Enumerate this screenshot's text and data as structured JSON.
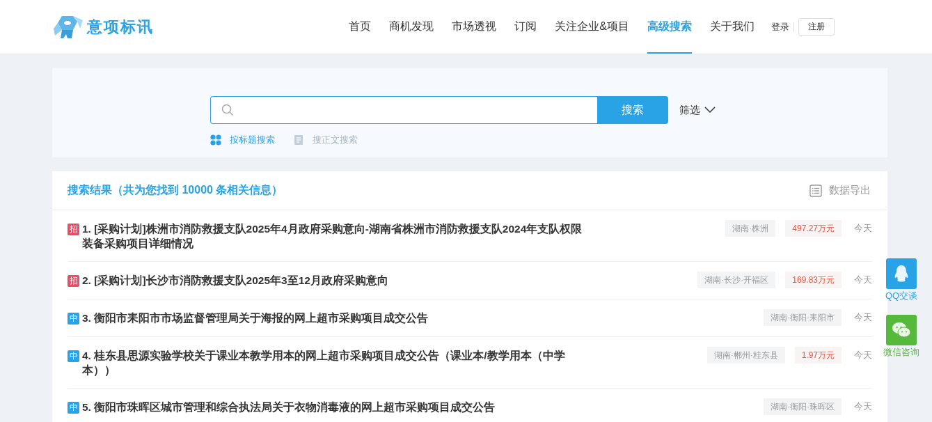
{
  "logo": {
    "text": "意项标讯"
  },
  "nav": [
    {
      "label": "首页",
      "selected": false
    },
    {
      "label": "商机发现",
      "selected": false
    },
    {
      "label": "市场透视",
      "selected": false
    },
    {
      "label": "订阅",
      "selected": false
    },
    {
      "label": "关注企业&项目",
      "selected": false
    },
    {
      "label": "高级搜索",
      "selected": true
    },
    {
      "label": "关于我们",
      "selected": false
    }
  ],
  "auth": {
    "login": "登录",
    "register": "注册"
  },
  "search": {
    "button": "搜索",
    "filter": "筛选",
    "modes": [
      {
        "label": "按标题搜索",
        "selected": true
      },
      {
        "label": "搜正文搜索",
        "selected": false
      }
    ]
  },
  "results": {
    "summary": "搜索结果（共为您找到 10000 条相关信息）",
    "export": "数据导出",
    "rows": [
      {
        "kind": "tender",
        "badge": "招",
        "title": "1. [采购计划]株洲市消防救援支队2025年4月政府采购意向-湖南省株洲市消防救援支队2024年支队权限装备采购项目详细情况",
        "region": "湖南·株洲",
        "amount": "497.27万元",
        "time": "今天"
      },
      {
        "kind": "tender",
        "badge": "招",
        "title": "2. [采购计划]长沙市消防救援支队2025年3至12月政府采购意向",
        "region": "湖南·长沙·开福区",
        "amount": "169.83万元",
        "time": "今天"
      },
      {
        "kind": "award",
        "badge": "中",
        "title": "3. 衡阳市耒阳市市场监督管理局关于海报的网上超市采购项目成交公告",
        "region": "湖南·衡阳·耒阳市",
        "time": "今天"
      },
      {
        "kind": "award",
        "badge": "中",
        "title": "4. 桂东县思源实验学校关于课业本教学用本的网上超市采购项目成交公告（课业本/教学用本（中学本））",
        "region": "湖南·郴州·桂东县",
        "amount": "1.97万元",
        "time": "今天"
      },
      {
        "kind": "award",
        "badge": "中",
        "title": "5. 衡阳市珠晖区城市管理和综合执法局关于衣物消毒液的网上超市采购项目成交公告",
        "region": "湖南·衡阳·珠晖区",
        "time": "今天"
      }
    ]
  },
  "float": [
    {
      "kind": "qq",
      "label": "QQ交谈"
    },
    {
      "kind": "wechat",
      "label": "微信咨询"
    }
  ]
}
